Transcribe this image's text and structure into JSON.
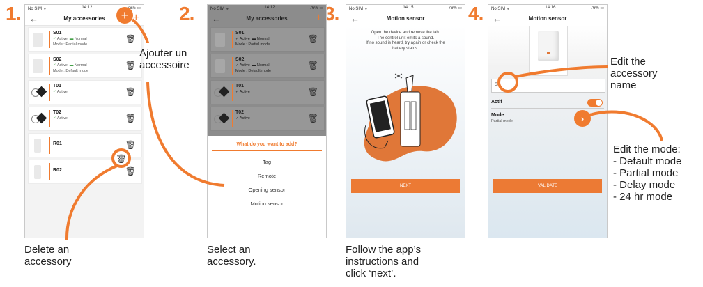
{
  "steps": [
    {
      "num": "1.",
      "title": "My accessories"
    },
    {
      "num": "2.",
      "title": "My accessories"
    },
    {
      "num": "3.",
      "title": "Motion sensor"
    },
    {
      "num": "4.",
      "title": "Motion sensor"
    }
  ],
  "status": {
    "p1": {
      "left": "No SIM ᯤ",
      "time": "14:12",
      "right": "76% ▭"
    },
    "p2": {
      "left": "No SIM ᯤ",
      "time": "14:12",
      "right": "76% ▭"
    },
    "p3": {
      "left": "No SIM ᯤ",
      "time": "14:15",
      "right": "76% ▭"
    },
    "p4": {
      "left": "No SIM ᯤ",
      "time": "14:16",
      "right": "76% ▭"
    }
  },
  "accessories": [
    {
      "name": "S01",
      "status": "Active",
      "battery": "Normal",
      "mode": "Mode : Partial mode"
    },
    {
      "name": "S02",
      "status": "Active",
      "battery": "Normal",
      "mode": "Mode : Default mode"
    },
    {
      "name": "T01",
      "status": "Active"
    },
    {
      "name": "T02",
      "status": "Active"
    },
    {
      "name": "R01"
    },
    {
      "name": "R02"
    }
  ],
  "add_sheet": {
    "title": "What do you want to add?",
    "options": [
      "Tag",
      "Remote",
      "Opening sensor",
      "Motion sensor"
    ]
  },
  "motion_sensor": {
    "instructions": [
      "Open the device and remove the tab.",
      "The control unit emits a sound.",
      "If no sound is heard, try again or check the",
      "battery status."
    ],
    "next_label": "NEXT"
  },
  "edit_screen": {
    "name_value": "S0",
    "actif_label": "Actif",
    "mode_label": "Mode",
    "mode_value": "Partial mode",
    "validate_label": "VALIDATE"
  },
  "annotations": {
    "add": [
      "Ajouter un",
      "accessoire"
    ],
    "delete": [
      "Delete an",
      "accessory"
    ],
    "select": [
      "Select an",
      "accessory."
    ],
    "follow": [
      "Follow the app’s",
      "instructions and",
      "click ‘next’."
    ],
    "edit_name": [
      "Edit the",
      "accessory",
      "name"
    ],
    "edit_mode": [
      "Edit the mode:",
      "- Default mode",
      "- Partial mode",
      "- Delay mode",
      "- 24 hr mode"
    ]
  },
  "colors": {
    "accent": "#f07b2f",
    "active": "#43a047"
  },
  "icons": [
    "back-arrow-icon",
    "plus-icon",
    "trash-icon",
    "check-icon",
    "battery-icon",
    "chevron-right-icon",
    "toggle-icon"
  ]
}
